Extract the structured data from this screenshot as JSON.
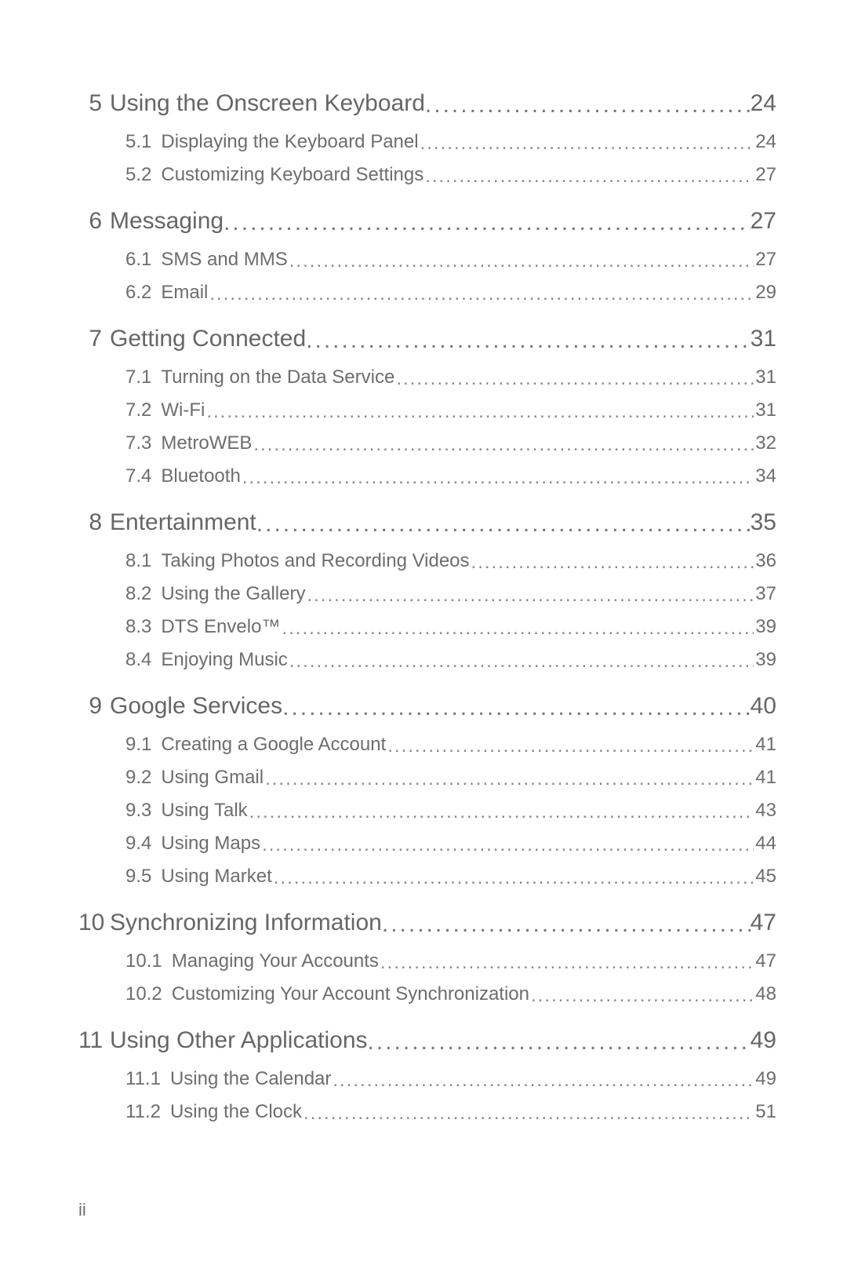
{
  "toc": [
    {
      "num": "5",
      "title": "Using the Onscreen Keyboard",
      "page": "24",
      "sections": [
        {
          "num": "5.1",
          "title": "Displaying the Keyboard Panel",
          "page": "24"
        },
        {
          "num": "5.2",
          "title": "Customizing Keyboard Settings",
          "page": "27"
        }
      ]
    },
    {
      "num": "6",
      "title": "Messaging",
      "page": "27",
      "sections": [
        {
          "num": "6.1",
          "title": "SMS and MMS",
          "page": "27"
        },
        {
          "num": "6.2",
          "title": "Email",
          "page": "29"
        }
      ]
    },
    {
      "num": "7",
      "title": "Getting Connected",
      "page": "31",
      "sections": [
        {
          "num": "7.1",
          "title": "Turning on the Data Service",
          "page": "31"
        },
        {
          "num": "7.2",
          "title": "Wi-Fi",
          "page": "31"
        },
        {
          "num": "7.3",
          "title": "MetroWEB",
          "page": "32"
        },
        {
          "num": "7.4",
          "title": "Bluetooth",
          "page": "34"
        }
      ]
    },
    {
      "num": "8",
      "title": "Entertainment",
      "page": "35",
      "sections": [
        {
          "num": "8.1",
          "title": "Taking Photos and Recording Videos",
          "page": "36"
        },
        {
          "num": "8.2",
          "title": "Using the Gallery",
          "page": "37"
        },
        {
          "num": "8.3",
          "title": "DTS Envelo™",
          "page": "39"
        },
        {
          "num": "8.4",
          "title": "Enjoying Music",
          "page": "39"
        }
      ]
    },
    {
      "num": "9",
      "title": "Google Services",
      "page": "40",
      "sections": [
        {
          "num": "9.1",
          "title": "Creating a Google Account",
          "page": "41"
        },
        {
          "num": "9.2",
          "title": "Using Gmail",
          "page": "41"
        },
        {
          "num": "9.3",
          "title": "Using Talk",
          "page": "43"
        },
        {
          "num": "9.4",
          "title": "Using Maps",
          "page": "44"
        },
        {
          "num": "9.5",
          "title": "Using Market",
          "page": "45"
        }
      ]
    },
    {
      "num": "10",
      "title": "Synchronizing Information",
      "page": "47",
      "sections": [
        {
          "num": "10.1",
          "title": "Managing Your Accounts",
          "page": "47"
        },
        {
          "num": "10.2",
          "title": "Customizing Your Account Synchronization",
          "page": "48"
        }
      ]
    },
    {
      "num": "11",
      "title": "Using Other Applications",
      "page": "49",
      "sections": [
        {
          "num": "11.1",
          "title": "Using the Calendar",
          "page": "49"
        },
        {
          "num": "11.2",
          "title": "Using the Clock",
          "page": "51"
        }
      ]
    }
  ],
  "page_number": "ii",
  "leader_dots_chapter": "..................................................................................................................................",
  "leader_dots_section": "..........................................................................................................................................................................."
}
